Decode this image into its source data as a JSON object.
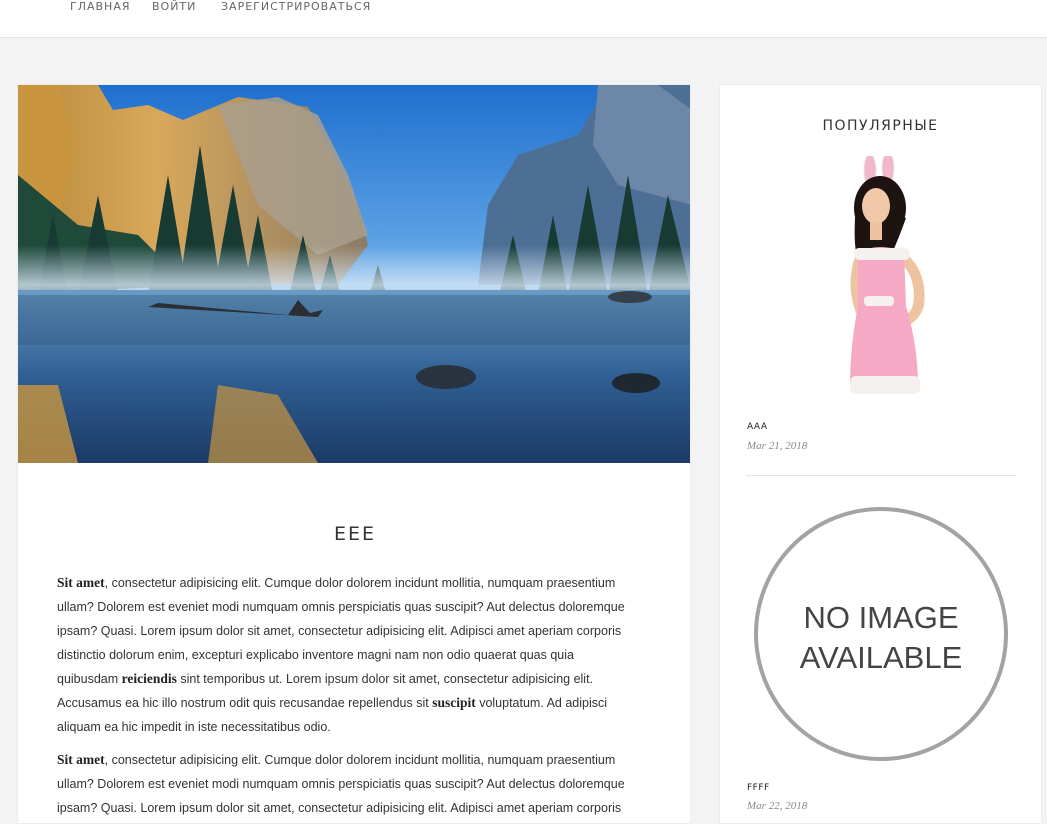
{
  "nav": {
    "items": [
      {
        "label": "ГЛАВНАЯ"
      },
      {
        "label": "ВОЙТИ"
      },
      {
        "label": "ЗАРЕГИСТРИРОВАТЬСЯ"
      }
    ]
  },
  "post": {
    "title": "EEE",
    "paragraphs": [
      {
        "b1": "Sit amet",
        "t1": ", consectetur adipisicing elit. Cumque dolor dolorem incidunt mollitia, numquam praesentium ullam? Dolorem est eveniet modi numquam omnis perspiciatis quas suscipit? Aut delectus doloremque ipsam? Quasi. Lorem ipsum dolor sit amet, consectetur adipisicing elit. Adipisci amet aperiam corporis distinctio dolorum enim, excepturi explicabo inventore magni nam non odio quaerat quas quia quibusdam ",
        "b2": "reiciendis",
        "t2": " sint temporibus ut. Lorem ipsum dolor sit amet, consectetur adipisicing elit. Accusamus ea hic illo nostrum odit quis recusandae repellendus sit ",
        "b3": "suscipit",
        "t3": " voluptatum. Ad adipisci aliquam ea hic impedit in iste necessitatibus odio."
      },
      {
        "b1": "Sit amet",
        "t1": ", consectetur adipisicing elit. Cumque dolor dolorem incidunt mollitia, numquam praesentium ullam? Dolorem est eveniet modi numquam omnis perspiciatis quas suscipit? Aut delectus doloremque ipsam? Quasi. Lorem ipsum dolor sit amet, consectetur adipisicing elit. Adipisci amet aperiam corporis"
      }
    ]
  },
  "sidebar": {
    "title": "ПОПУЛЯРНЫЕ",
    "items": [
      {
        "title": "AAA",
        "date": "Mar 21, 2018"
      },
      {
        "title": "FFFF",
        "date": "Mar 22, 2018",
        "placeholder_line1": "NO IMAGE",
        "placeholder_line2": "AVAILABLE"
      }
    ]
  }
}
